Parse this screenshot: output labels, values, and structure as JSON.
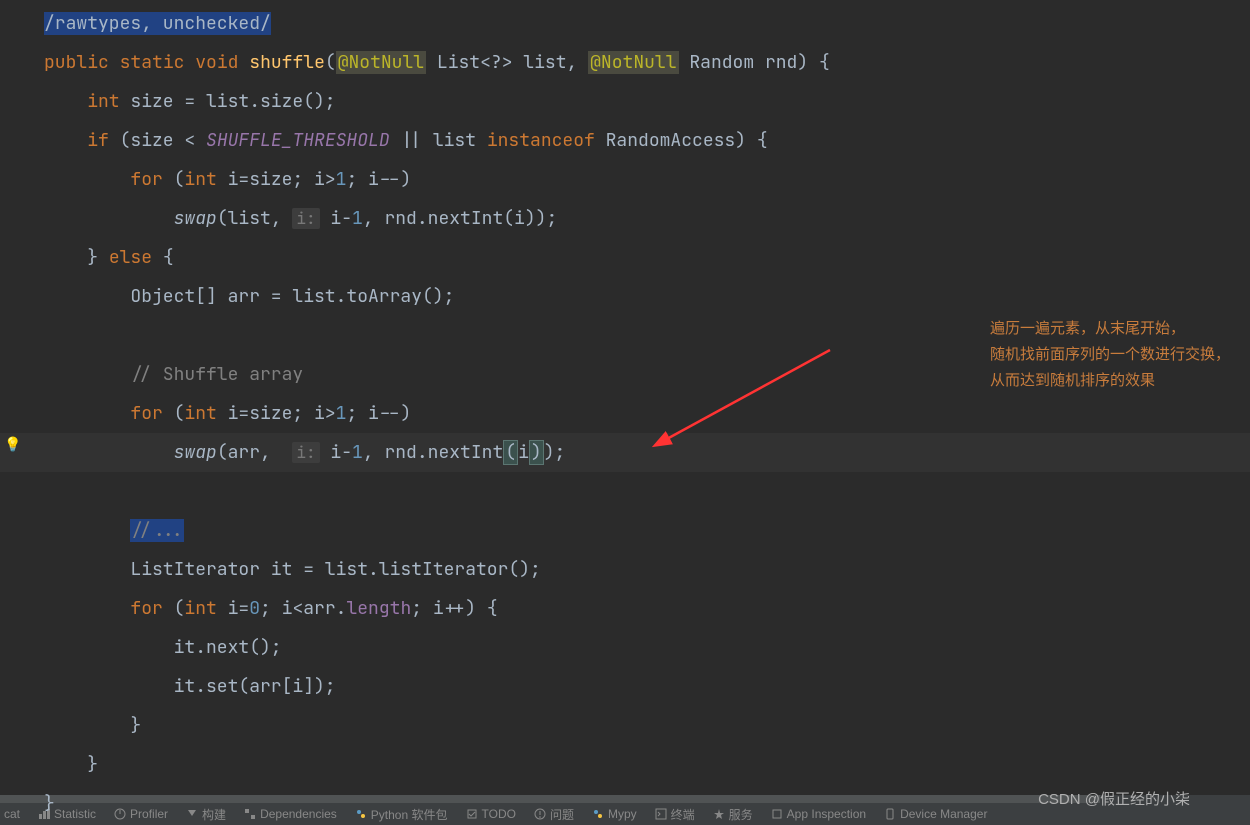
{
  "code": {
    "suppress": "/rawtypes, unchecked/",
    "sig_public": "public",
    "sig_static": "static",
    "sig_void": "void",
    "sig_method": "shuffle",
    "sig_anno1": "@NotNull",
    "sig_list": "List<?> list,",
    "sig_anno2": "@NotNull",
    "sig_random": "Random rnd) {",
    "l2_int": "int",
    "l2_rest": " size = list.size();",
    "l3_if": "if",
    "l3_open": " (size < ",
    "l3_thresh": "SHUFFLE_THRESHOLD",
    "l3_mid": " || list ",
    "l3_inst": "instanceof",
    "l3_end": " RandomAccess) {",
    "l4_for": "for",
    "l4_open": " (",
    "l4_int": "int",
    "l4_body": " i=size; i>",
    "l4_one": "1",
    "l4_end": "; i--)",
    "l5_swap": "swap",
    "l5_open": "(list, ",
    "l5_hint": "i:",
    "l5_mid": " i-",
    "l5_one": "1",
    "l5_end": ", rnd.nextInt(i));",
    "l6": "} ",
    "l6_else": "else",
    "l6_end": " {",
    "l7": "Object[] arr = list.toArray();",
    "l9_comment": "// Shuffle array",
    "l10_for": "for",
    "l10_open": " (",
    "l10_int": "int",
    "l10_body": " i=size; i>",
    "l10_one": "1",
    "l10_end": "; i--)",
    "l11_swap": "swap",
    "l11_open": "(arr,  ",
    "l11_hint": "i:",
    "l11_mid": " i-",
    "l11_one": "1",
    "l11_next": ", rnd.nextInt",
    "l11_p1": "(",
    "l11_i": "i",
    "l11_p2": ")",
    "l11_end": ");",
    "l13_comment": "//...",
    "l14": "ListIterator it = list.listIterator();",
    "l15_for": "for",
    "l15_open": " (",
    "l15_int": "int",
    "l15_body": " i=",
    "l15_zero": "0",
    "l15_mid": "; i<arr.",
    "l15_len": "length",
    "l15_end": "; i++) {",
    "l16": "it.next();",
    "l17": "it.set(arr[i]);",
    "l18": "}",
    "l19": "}",
    "l20": "}"
  },
  "annotation": {
    "line1": "遍历一遍元素，从末尾开始，",
    "line2": "随机找前面序列的一个数进行交换，",
    "line3": "从而达到随机排序的效果"
  },
  "watermark": "CSDN @假正经的小柒",
  "status": {
    "items": [
      "cat",
      "Statistic",
      "Profiler",
      "构建",
      "Dependencies",
      "Python 软件包",
      "TODO",
      "问题",
      "Mypy",
      "终端",
      "服务",
      "App Inspection",
      "Device Manager"
    ]
  }
}
